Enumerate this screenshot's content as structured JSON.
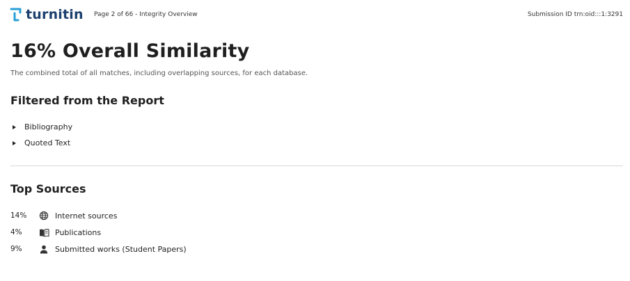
{
  "header": {
    "logo_text": "turnitin",
    "page_info": "Page 2 of 66 - Integrity Overview",
    "submission_id": "Submission ID trn:oid:::1:3291"
  },
  "overview": {
    "title": "16% Overall Similarity",
    "subtitle": "The combined total of all matches, including overlapping sources, for each database."
  },
  "filtered": {
    "heading": "Filtered from the Report",
    "items": [
      {
        "label": "Bibliography"
      },
      {
        "label": "Quoted Text"
      }
    ]
  },
  "top_sources": {
    "heading": "Top Sources",
    "rows": [
      {
        "percent": "14%",
        "icon": "globe-icon",
        "label": "Internet sources"
      },
      {
        "percent": "4%",
        "icon": "book-icon",
        "label": "Publications"
      },
      {
        "percent": "9%",
        "icon": "person-icon",
        "label": "Submitted works (Student Papers)"
      }
    ]
  },
  "colors": {
    "brand": "#1c3f6e",
    "logo_accent": "#2a9fd6",
    "text": "#1f1f1f",
    "muted": "#555555",
    "divider": "#d8d8d8"
  }
}
